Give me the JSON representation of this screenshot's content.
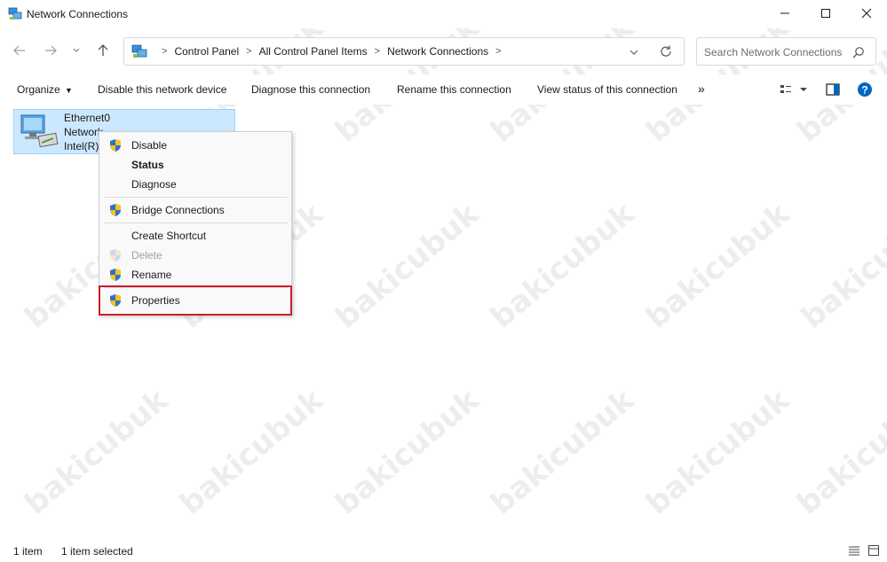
{
  "window": {
    "title": "Network Connections",
    "controls": {
      "minimize": "minimize",
      "maximize": "maximize",
      "close": "close"
    }
  },
  "address": {
    "breadcrumbs": [
      "Control Panel",
      "All Control Panel Items",
      "Network Connections"
    ]
  },
  "search": {
    "placeholder": "Search Network Connections"
  },
  "toolbar": {
    "organize": "Organize",
    "disable_device": "Disable this network device",
    "diagnose": "Diagnose this connection",
    "rename": "Rename this connection",
    "view_status": "View status of this connection",
    "more": "»"
  },
  "connection": {
    "name": "Ethernet0",
    "line2": "Network",
    "line3": "Intel(R)"
  },
  "context_menu": {
    "disable": "Disable",
    "status": "Status",
    "diagnose": "Diagnose",
    "bridge": "Bridge Connections",
    "shortcut": "Create Shortcut",
    "delete": "Delete",
    "rename": "Rename",
    "properties": "Properties"
  },
  "status": {
    "count": "1 item",
    "selected": "1 item selected"
  },
  "watermark": "bakicubuk",
  "colors": {
    "selection_bg": "#cce8ff",
    "selection_border": "#99d1ff",
    "highlight_red": "#cc1f2a",
    "help_blue": "#0067c0"
  }
}
